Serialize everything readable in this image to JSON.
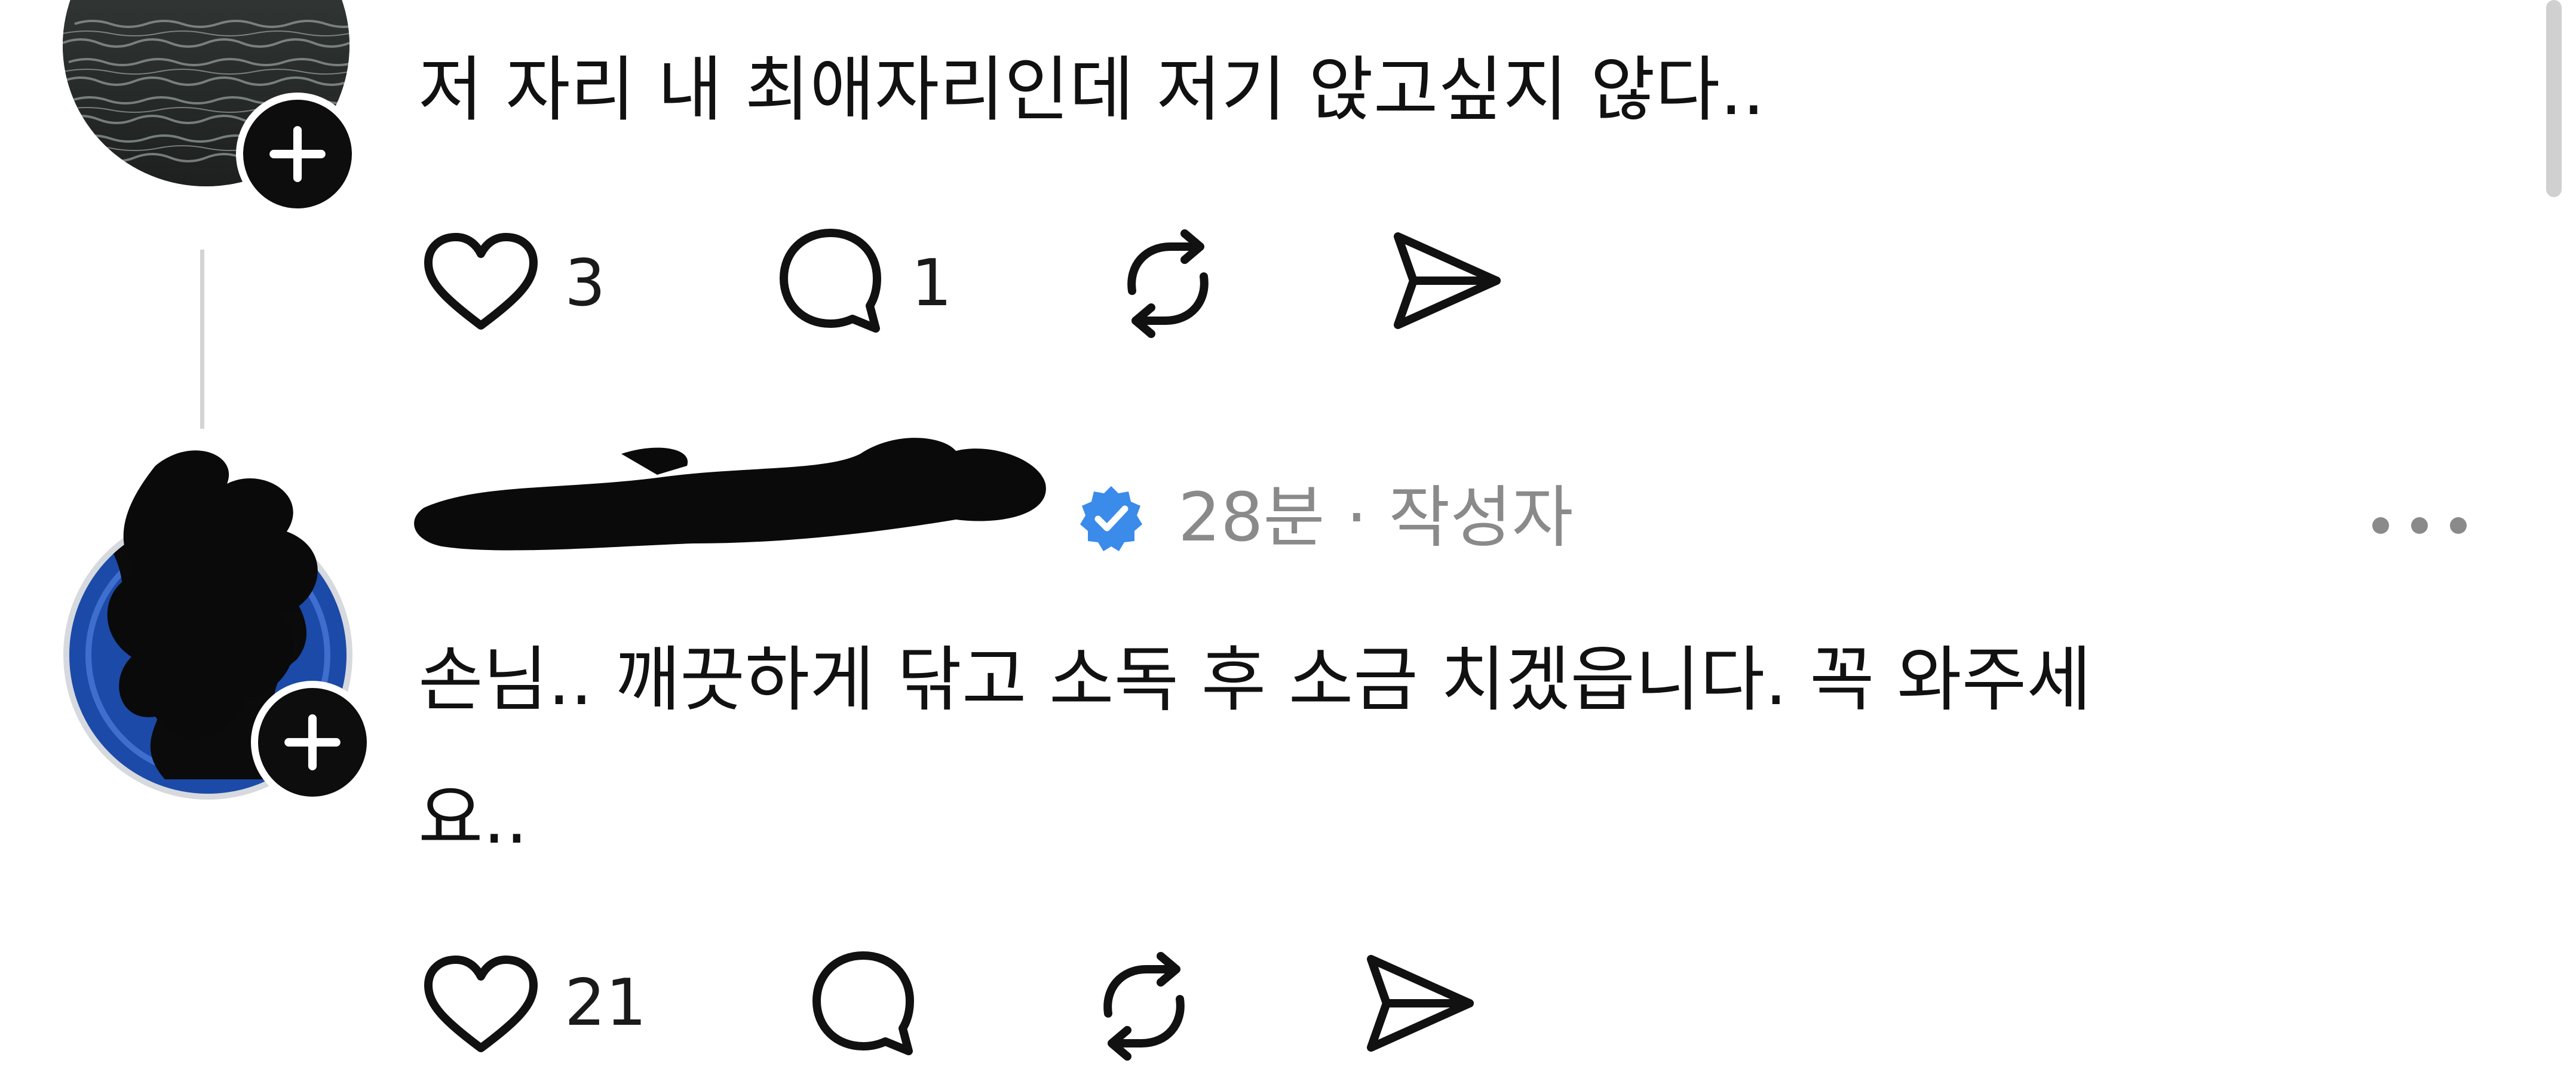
{
  "comments": [
    {
      "text": "저 자리 내 최애자리인데 저기 앉고싶지 않다..",
      "likes": "3",
      "replies": "1"
    },
    {
      "meta": "28분 · 작성자",
      "text_line1": "손님.. 깨끗하게 닦고 소독 후 소금 치겠읍니다. 꼭 와주세",
      "text_line2": "요..",
      "likes": "21"
    }
  ],
  "icons": {
    "like": "heart-icon",
    "reply": "speech-bubble-icon",
    "repost": "repost-icon",
    "share": "paper-plane-icon",
    "follow": "plus-icon",
    "verified": "verified-badge-icon",
    "more": "more-dots-icon"
  },
  "colors": {
    "verified": "#3a8bea",
    "text": "#111111",
    "muted": "#8a8a8a"
  }
}
